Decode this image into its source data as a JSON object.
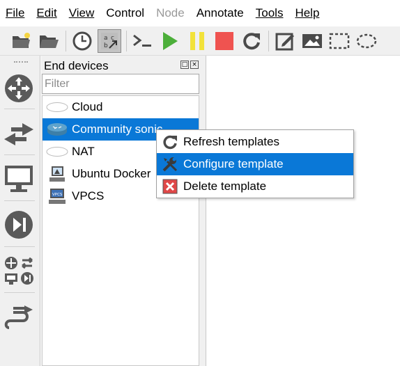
{
  "menubar": {
    "items": [
      {
        "label": "File"
      },
      {
        "label": "Edit"
      },
      {
        "label": "View"
      },
      {
        "label": "Control"
      },
      {
        "label": "Node",
        "disabled": true
      },
      {
        "label": "Annotate"
      },
      {
        "label": "Tools"
      },
      {
        "label": "Help"
      }
    ]
  },
  "toolbar": {
    "buttons": [
      {
        "icon": "new-project-icon"
      },
      {
        "icon": "open-project-icon"
      },
      {
        "icon": "snapshot-clock-icon"
      },
      {
        "icon": "show-interface-labels-icon",
        "pressed": true
      },
      {
        "icon": "console-icon"
      },
      {
        "icon": "start-icon",
        "color": "#4caf3a"
      },
      {
        "icon": "pause-icon",
        "color": "#f2e23a"
      },
      {
        "icon": "stop-icon",
        "color": "#ef5350"
      },
      {
        "icon": "reload-icon"
      },
      {
        "icon": "add-note-icon"
      },
      {
        "icon": "insert-image-icon"
      },
      {
        "icon": "draw-rectangle-icon"
      },
      {
        "icon": "draw-ellipse-icon"
      }
    ]
  },
  "dock": {
    "buttons": [
      {
        "icon": "routers-icon"
      },
      {
        "icon": "switches-icon"
      },
      {
        "icon": "end-devices-icon"
      },
      {
        "icon": "security-devices-icon"
      },
      {
        "icon": "all-devices-icon"
      },
      {
        "icon": "add-link-icon"
      }
    ]
  },
  "panel": {
    "title": "End devices",
    "filter_placeholder": "Filter",
    "items": [
      {
        "label": "Cloud",
        "icon": "cloud-icon"
      },
      {
        "label": "Community sonic",
        "icon": "router-icon",
        "selected": true
      },
      {
        "label": "NAT",
        "icon": "nat-cloud-icon"
      },
      {
        "label": "Ubuntu Docker",
        "icon": "docker-host-icon"
      },
      {
        "label": "VPCS",
        "icon": "vpcs-icon"
      }
    ]
  },
  "context_menu": {
    "items": [
      {
        "label": "Refresh templates",
        "icon": "refresh-icon"
      },
      {
        "label": "Configure template",
        "icon": "wrench-screwdriver-icon",
        "active": true
      },
      {
        "label": "Delete template",
        "icon": "delete-icon"
      }
    ]
  },
  "colors": {
    "selection": "#0a78d7",
    "start": "#4caf3a",
    "pause": "#f2e23a",
    "stop": "#ef5350"
  }
}
